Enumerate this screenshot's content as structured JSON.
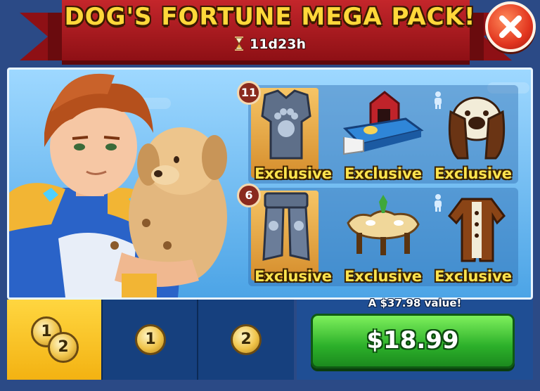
{
  "header": {
    "title": "DOG'S FORTUNE MEGA PACK!",
    "timer": "11d23h",
    "timer_icon": "hourglass-icon",
    "close_icon": "close-icon"
  },
  "colors": {
    "title_yellow": "#ffd83a",
    "ribbon_red": "#c4262b",
    "buy_green": "#2cb02a",
    "tab_selected": "#f3b212",
    "tab_default": "#16407e",
    "panel_blue": "#4ca4e6"
  },
  "items": [
    {
      "name": "paw armor chest",
      "icon": "armor-chest-icon",
      "label": "Exclusive",
      "count": "11"
    },
    {
      "name": "dog bed with doghouse",
      "icon": "dog-bed-icon",
      "label": "Exclusive",
      "count": null
    },
    {
      "name": "beagle dog hat",
      "icon": "dog-hat-icon",
      "label": "Exclusive",
      "count": null,
      "person_icon": "person-icon"
    },
    {
      "name": "armor leg greaves",
      "icon": "armor-legs-icon",
      "label": "Exclusive",
      "count": "6"
    },
    {
      "name": "paw shaped table",
      "icon": "table-icon",
      "label": "Exclusive",
      "count": null
    },
    {
      "name": "dog onesie costume",
      "icon": "dog-costume-icon",
      "label": "Exclusive",
      "count": null,
      "person_icon": "person-icon"
    }
  ],
  "tabs": [
    {
      "coins": [
        "1",
        "2"
      ],
      "selected": true
    },
    {
      "coins": [
        "1"
      ],
      "selected": false
    },
    {
      "coins": [
        "2"
      ],
      "selected": false
    }
  ],
  "purchase": {
    "value_text": "A $37.98 value!",
    "price": "$18.99"
  }
}
